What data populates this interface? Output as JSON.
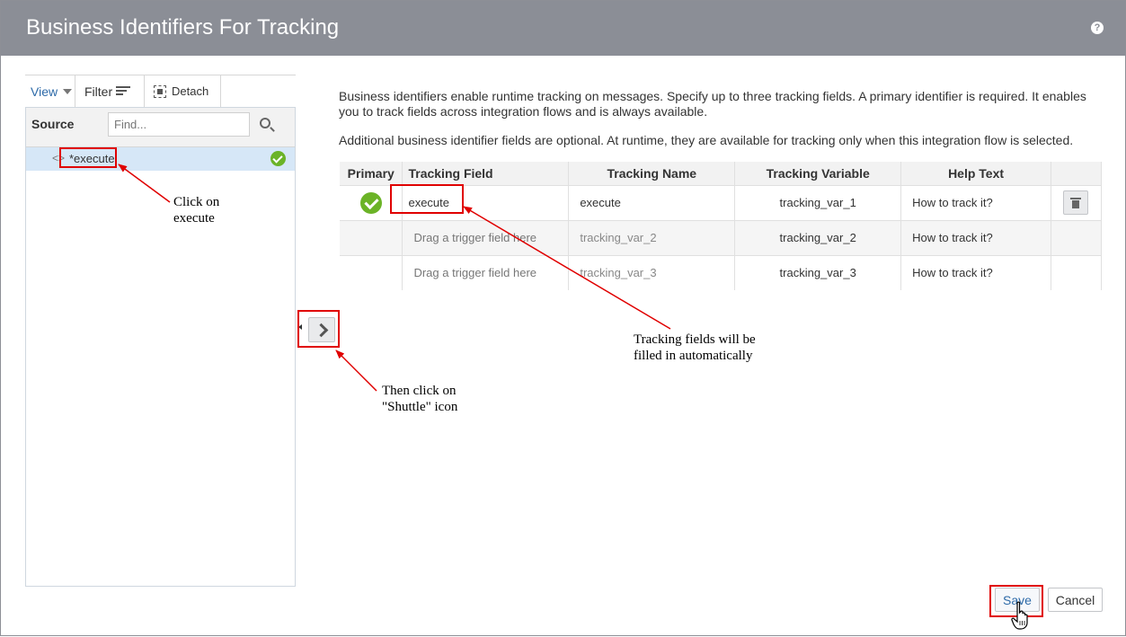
{
  "dialog": {
    "title": "Business Identifiers For Tracking",
    "help_icon": "question-icon"
  },
  "toolbar": {
    "view_label": "View",
    "filter_label": "Filter",
    "detach_label": "Detach"
  },
  "source": {
    "label": "Source",
    "find_placeholder": "Find...",
    "tree_item": "*execute",
    "tree_toggle": "<>"
  },
  "description": {
    "line1": "Business identifiers enable runtime tracking on messages. Specify up to three tracking fields. A primary identifier is required. It enables",
    "line2": "you to track fields across integration flows and is always available.",
    "line3": "Additional business identifier fields are optional. At runtime, they are available for tracking only when this integration flow is selected."
  },
  "table": {
    "headers": {
      "primary": "Primary",
      "field": "Tracking Field",
      "name": "Tracking Name",
      "variable": "Tracking Variable",
      "help": "Help Text"
    },
    "rows": [
      {
        "field": "execute",
        "name": "execute",
        "variable": "tracking_var_1",
        "help": "How to track it?"
      },
      {
        "field": "Drag a trigger field here",
        "name": "tracking_var_2",
        "variable": "tracking_var_2",
        "help": "How to track it?"
      },
      {
        "field": "Drag a trigger field here",
        "name": "tracking_var_3",
        "variable": "tracking_var_3",
        "help": "How to track it?"
      }
    ]
  },
  "annotations": {
    "click_execute_1": "Click on",
    "click_execute_2": "execute",
    "shuttle_1": "Then click on",
    "shuttle_2": "\"Shuttle\" icon",
    "tracking_1": "Tracking fields will be",
    "tracking_2": "filled in automatically"
  },
  "footer": {
    "save_label": "Save",
    "cancel_label": "Cancel"
  },
  "colors": {
    "header_bg": "#8b8e96",
    "accent_blue": "#2d6aa8",
    "check_green": "#6bb327",
    "annotation_red": "#e00000"
  }
}
